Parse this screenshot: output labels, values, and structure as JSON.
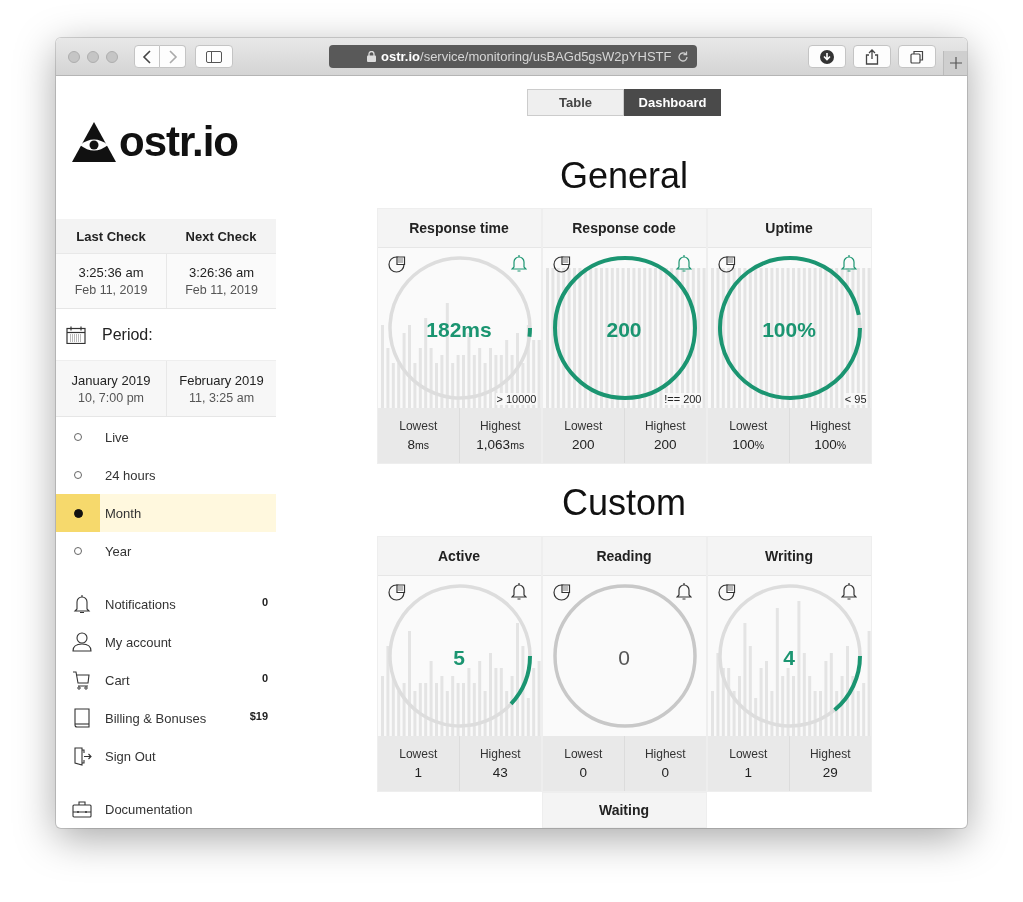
{
  "browser": {
    "url": "**ostr.io**/service/monitoring/usBAGd5gsW2pYHSTF"
  },
  "sidebar": {
    "logo": "ostr.io",
    "checks": [
      {
        "label": "Last Check",
        "time": "3:25:36 am",
        "date": "Feb 11, 2019"
      },
      {
        "label": "Next Check",
        "time": "3:26:36 am",
        "date": "Feb 11, 2019"
      }
    ],
    "period_label": "Period:",
    "period": [
      {
        "month": "January 2019",
        "time": "10, 7:00 pm"
      },
      {
        "month": "February 2019",
        "time": "11, 3:25 am"
      }
    ],
    "ranges": [
      {
        "label": "Live",
        "selected": false
      },
      {
        "label": "24 hours",
        "selected": false
      },
      {
        "label": "Month",
        "selected": true
      },
      {
        "label": "Year",
        "selected": false
      }
    ],
    "menu": [
      {
        "kind": "bell",
        "label": "Notifications",
        "badge": "0"
      },
      {
        "kind": "user",
        "label": "My account"
      },
      {
        "kind": "cart",
        "label": "Cart",
        "badge": "0"
      },
      {
        "kind": "book",
        "label": "Billing & Bonuses",
        "badge": "$19"
      },
      {
        "kind": "exit",
        "label": "Sign Out"
      },
      {
        "kind": "briefcase",
        "label": "Documentation"
      }
    ]
  },
  "view_tabs": [
    {
      "label": "Table",
      "selected": false
    },
    {
      "label": "Dashboard",
      "selected": true
    }
  ],
  "sections": [
    {
      "title": "General",
      "cards": [
        {
          "title": "Response time",
          "value": "182ms",
          "level": 0.02,
          "alert": true,
          "kind": "varied",
          "threshold": "> 10000",
          "stats": [
            {
              "label": "Lowest",
              "value": "8",
              "unit": "ms"
            },
            {
              "label": "Highest",
              "value": "1,063",
              "unit": "ms"
            }
          ]
        },
        {
          "title": "Response code",
          "value": "200",
          "level": 1,
          "alert": true,
          "kind": "full",
          "threshold": "!== 200",
          "stats": [
            {
              "label": "Lowest",
              "value": "200"
            },
            {
              "label": "Highest",
              "value": "200"
            }
          ]
        },
        {
          "title": "Uptime",
          "value": "100%",
          "level": 0.97,
          "alert": true,
          "kind": "full",
          "threshold": "< 95",
          "stats": [
            {
              "label": "Lowest",
              "value": "100",
              "unit": "%"
            },
            {
              "label": "Highest",
              "value": "100",
              "unit": "%"
            }
          ]
        }
      ]
    },
    {
      "title": "Custom",
      "cards": [
        {
          "title": "Active",
          "value": "5",
          "level": 0.12,
          "alert": false,
          "kind": "varied",
          "stats": [
            {
              "label": "Lowest",
              "value": "1"
            },
            {
              "label": "Highest",
              "value": "43"
            }
          ]
        },
        {
          "title": "Reading",
          "value": "0",
          "level": 0,
          "alert": false,
          "kind": "empty",
          "stats": [
            {
              "label": "Lowest",
              "value": "0"
            },
            {
              "label": "Highest",
              "value": "0"
            }
          ]
        },
        {
          "title": "Writing",
          "value": "4",
          "level": 0.14,
          "alert": false,
          "kind": "varied",
          "stats": [
            {
              "label": "Lowest",
              "value": "1"
            },
            {
              "label": "Highest",
              "value": "29"
            }
          ]
        }
      ],
      "overflow_card": {
        "title": "Waiting"
      }
    }
  ]
}
